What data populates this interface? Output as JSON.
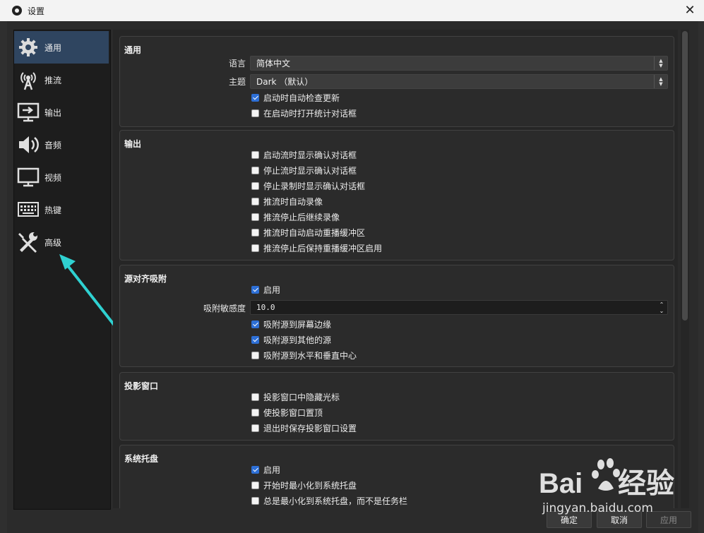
{
  "window": {
    "title": "设置"
  },
  "sidebar": {
    "items": [
      {
        "label": "通用",
        "icon": "gear-icon",
        "active": true
      },
      {
        "label": "推流",
        "icon": "antenna-icon",
        "active": false
      },
      {
        "label": "输出",
        "icon": "output-icon",
        "active": false
      },
      {
        "label": "音频",
        "icon": "speaker-icon",
        "active": false
      },
      {
        "label": "视频",
        "icon": "monitor-icon",
        "active": false
      },
      {
        "label": "热键",
        "icon": "keyboard-icon",
        "active": false
      },
      {
        "label": "高级",
        "icon": "tools-icon",
        "active": false
      }
    ]
  },
  "general": {
    "title": "通用",
    "language_label": "语言",
    "language_value": "简体中文",
    "theme_label": "主题",
    "theme_value": "Dark （默认）",
    "checks": [
      {
        "label": "启动时自动检查更新",
        "checked": true
      },
      {
        "label": "在启动时打开统计对话框",
        "checked": false
      }
    ]
  },
  "output": {
    "title": "输出",
    "checks": [
      {
        "label": "启动流时显示确认对话框",
        "checked": false
      },
      {
        "label": "停止流时显示确认对话框",
        "checked": false
      },
      {
        "label": "停止录制时显示确认对话框",
        "checked": false
      },
      {
        "label": "推流时自动录像",
        "checked": false
      },
      {
        "label": "推流停止后继续录像",
        "checked": false
      },
      {
        "label": "推流时自动启动重播缓冲区",
        "checked": false
      },
      {
        "label": "推流停止后保持重播缓冲区启用",
        "checked": false
      }
    ]
  },
  "snapping": {
    "title": "源对齐吸附",
    "enable": {
      "label": "启用",
      "checked": true
    },
    "sensitivity_label": "吸附敏感度",
    "sensitivity_value": "10.0",
    "checks": [
      {
        "label": "吸附源到屏幕边缘",
        "checked": true
      },
      {
        "label": "吸附源到其他的源",
        "checked": true
      },
      {
        "label": "吸附源到水平和垂直中心",
        "checked": false
      }
    ]
  },
  "projector": {
    "title": "投影窗口",
    "checks": [
      {
        "label": "投影窗口中隐藏光标",
        "checked": false
      },
      {
        "label": "使投影窗口置顶",
        "checked": false
      },
      {
        "label": "退出时保存投影窗口设置",
        "checked": false
      }
    ]
  },
  "tray": {
    "title": "系统托盘",
    "checks": [
      {
        "label": "启用",
        "checked": true
      },
      {
        "label": "开始时最小化到系统托盘",
        "checked": false
      },
      {
        "label": "总是最小化到系统托盘，而不是任务栏",
        "checked": false
      }
    ]
  },
  "footer": {
    "ok": "确定",
    "cancel": "取消",
    "apply": "应用"
  },
  "watermark": {
    "brand": "Baidu经验",
    "url": "jingyan.baidu.com"
  },
  "colors": {
    "accent": "#2d6fd6",
    "active_nav": "#2f4560",
    "annotation_arrow": "#2fd1d1"
  }
}
